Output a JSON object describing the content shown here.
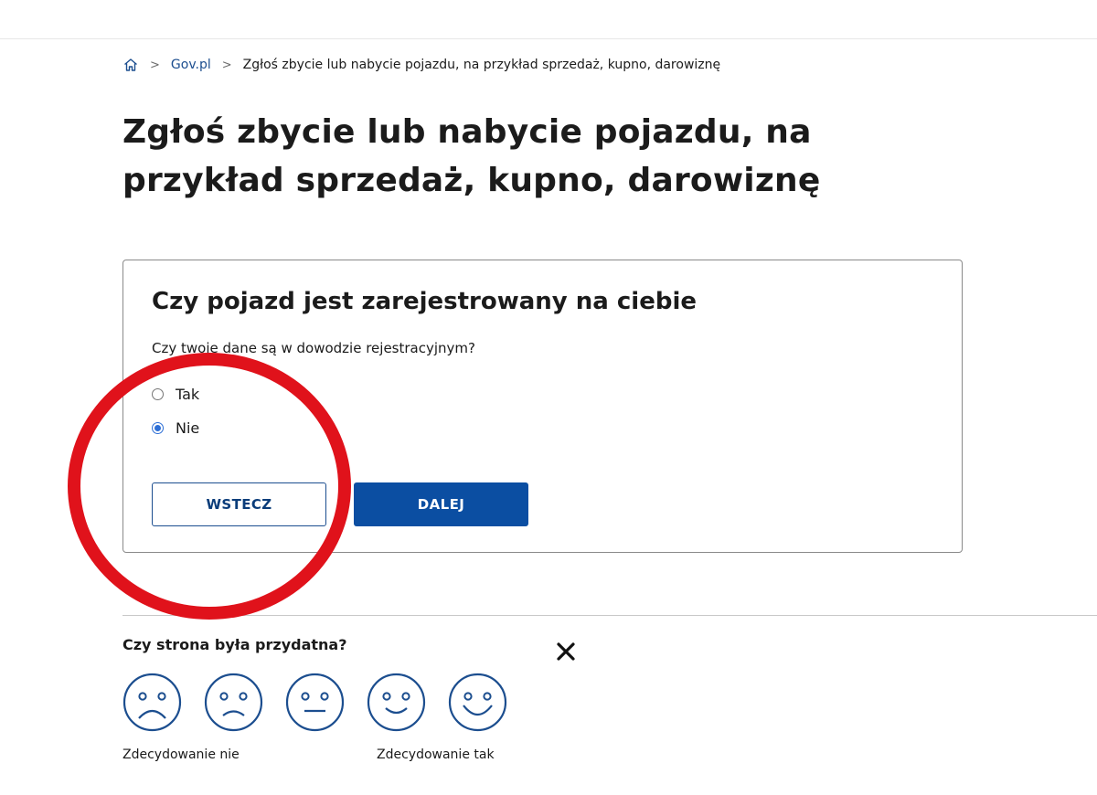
{
  "breadcrumb": {
    "home_icon": "home-icon",
    "items": [
      "Gov.pl",
      "Zgłoś zbycie lub nabycie pojazdu, na przykład sprzedaż, kupno, darowiznę"
    ]
  },
  "page": {
    "title": "Zgłoś zbycie lub nabycie pojazdu, na przykład sprzedaż, kupno, darowiznę"
  },
  "form": {
    "title": "Czy pojazd jest zarejestrowany na ciebie",
    "question": "Czy twoje dane są w dowodzie rejestracyjnym?",
    "options": [
      {
        "label": "Tak",
        "selected": false
      },
      {
        "label": "Nie",
        "selected": true
      }
    ],
    "back_label": "WSTECZ",
    "next_label": "DALEJ"
  },
  "feedback": {
    "question": "Czy strona była przydatna?",
    "label_no": "Zdecydowanie nie",
    "label_yes": "Zdecydowanie tak",
    "close_icon": "close-icon",
    "faces": [
      "very-sad-face-icon",
      "sad-face-icon",
      "neutral-face-icon",
      "happy-face-icon",
      "very-happy-face-icon"
    ]
  },
  "colors": {
    "primary": "#0b4ea2",
    "link": "#1c4e8f",
    "annotation": "#e0121b",
    "radio_checked": "#2d6fd6"
  }
}
